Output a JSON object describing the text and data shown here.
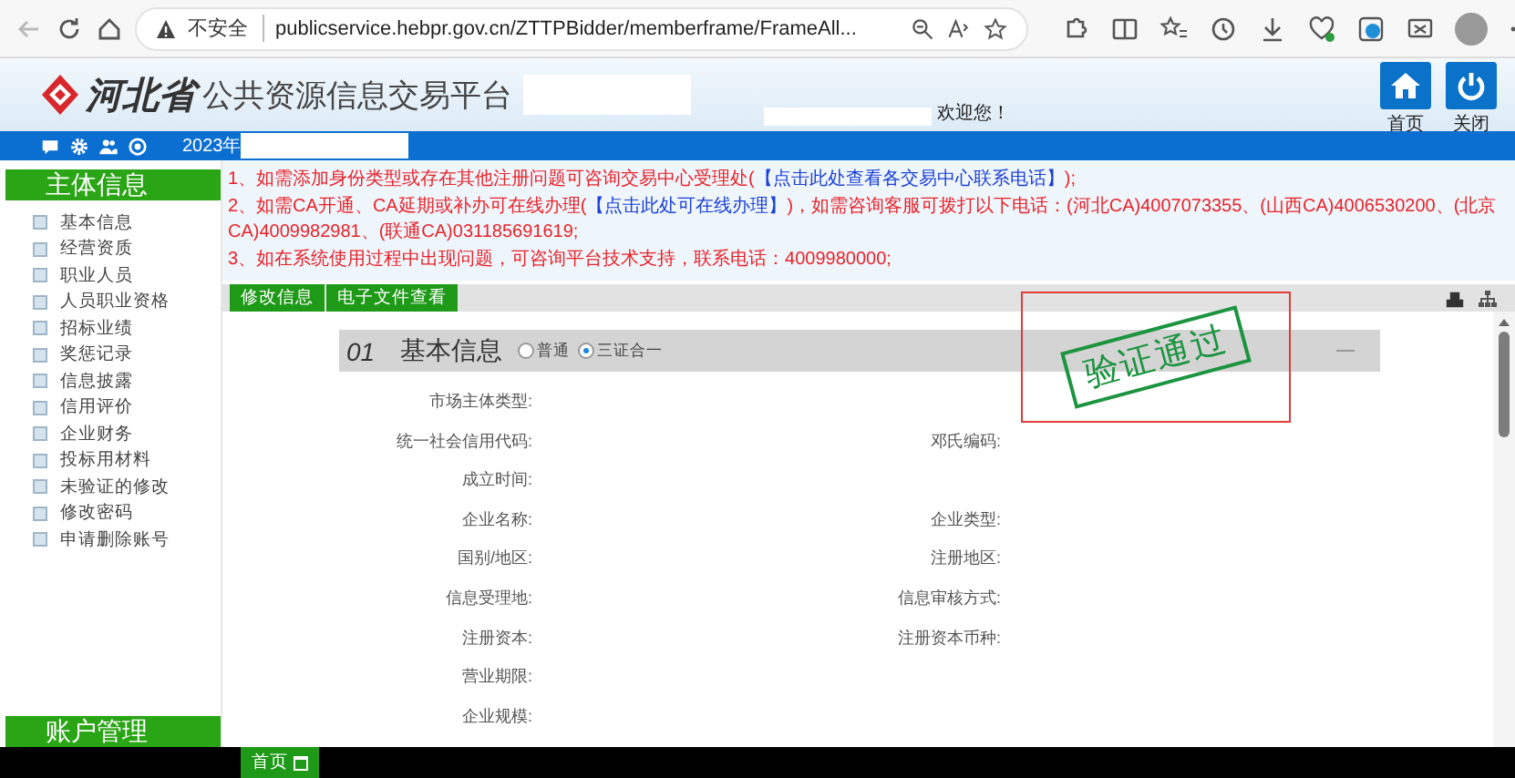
{
  "browser": {
    "security": "不安全",
    "url": "publicservice.hebpr.gov.cn/ZTTPBidder/memberframe/FrameAll..."
  },
  "header": {
    "province": "河北省",
    "platform": "公共资源信息交易平台",
    "welcome": "欢迎您！",
    "buttons": [
      {
        "kind": "home",
        "label": "首页"
      },
      {
        "kind": "power",
        "label": "关闭"
      }
    ]
  },
  "blue_bar": {
    "year": "2023年"
  },
  "sidebar": {
    "title": "主体信息",
    "items": [
      "基本信息",
      "经营资质",
      "职业人员",
      "人员职业资格",
      "招标业绩",
      "奖惩记录",
      "信息披露",
      "信用评价",
      "企业财务",
      "投标用材料",
      "未验证的修改",
      "修改密码",
      "申请删除账号"
    ],
    "footer": "账户管理"
  },
  "notices": [
    {
      "parts": [
        {
          "kind": "text",
          "text": "1、如需添加身份类型或存在其他注册问题可咨询交易中心受理处("
        },
        {
          "kind": "link",
          "text": "【点击此处查看各交易中心联系电话】"
        },
        {
          "kind": "text",
          "text": ");"
        }
      ]
    },
    {
      "parts": [
        {
          "kind": "text",
          "text": "2、如需CA开通、CA延期或补办可在线办理("
        },
        {
          "kind": "link",
          "text": "【点击此处可在线办理】"
        },
        {
          "kind": "text",
          "text": ")，如需咨询客服可拨打以下电话：(河北CA)4007073355、(山西CA)4006530200、(北京CA)4009982981、(联通CA)031185691619;"
        }
      ]
    },
    {
      "parts": [
        {
          "kind": "text",
          "text": "3、如在系统使用过程中出现问题，可咨询平台技术支持，联系电话：4009980000;"
        }
      ]
    }
  ],
  "toolbar": {
    "buttons": [
      "修改信息",
      "电子文件查看"
    ]
  },
  "section": {
    "number": "01",
    "title": "基本信息",
    "options": [
      {
        "label": "普通",
        "selected": false
      },
      {
        "label": "三证合一",
        "selected": true
      }
    ]
  },
  "stamp": "验证通过",
  "fields": [
    {
      "left": "市场主体类型:"
    },
    {
      "left": "统一社会信用代码:",
      "right": "邓氏编码:"
    },
    {
      "left": "成立时间:"
    },
    {
      "left": "企业名称:",
      "right": "企业类型:"
    },
    {
      "left": "国别/地区:",
      "right": "注册地区:"
    },
    {
      "left": "信息受理地:",
      "right": "信息审核方式:"
    },
    {
      "left": "注册资本:",
      "right": "注册资本币种:"
    },
    {
      "left": "营业期限:"
    },
    {
      "left": "企业规模:"
    }
  ],
  "footer_tab": "首页"
}
